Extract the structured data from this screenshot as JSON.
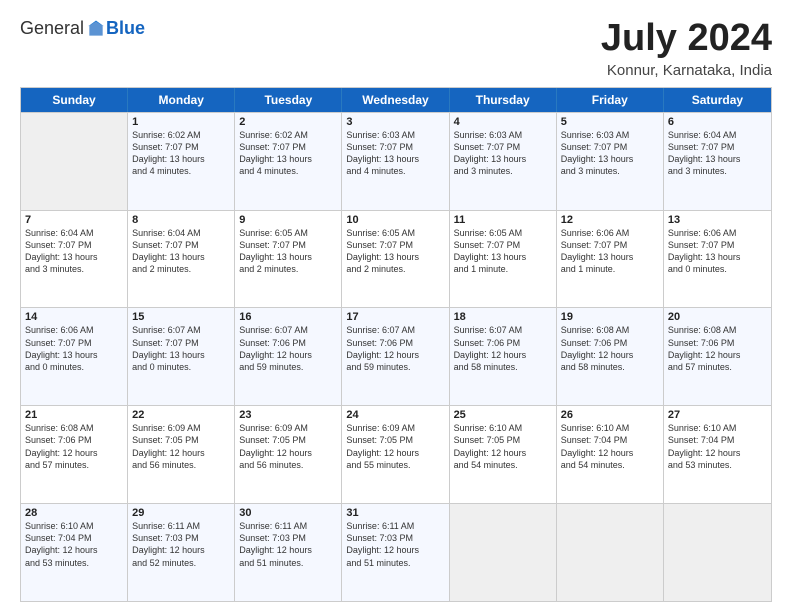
{
  "header": {
    "logo_general": "General",
    "logo_blue": "Blue",
    "month_title": "July 2024",
    "location": "Konnur, Karnataka, India"
  },
  "weekdays": [
    "Sunday",
    "Monday",
    "Tuesday",
    "Wednesday",
    "Thursday",
    "Friday",
    "Saturday"
  ],
  "rows": [
    [
      {
        "day": "",
        "lines": []
      },
      {
        "day": "1",
        "lines": [
          "Sunrise: 6:02 AM",
          "Sunset: 7:07 PM",
          "Daylight: 13 hours",
          "and 4 minutes."
        ]
      },
      {
        "day": "2",
        "lines": [
          "Sunrise: 6:02 AM",
          "Sunset: 7:07 PM",
          "Daylight: 13 hours",
          "and 4 minutes."
        ]
      },
      {
        "day": "3",
        "lines": [
          "Sunrise: 6:03 AM",
          "Sunset: 7:07 PM",
          "Daylight: 13 hours",
          "and 4 minutes."
        ]
      },
      {
        "day": "4",
        "lines": [
          "Sunrise: 6:03 AM",
          "Sunset: 7:07 PM",
          "Daylight: 13 hours",
          "and 3 minutes."
        ]
      },
      {
        "day": "5",
        "lines": [
          "Sunrise: 6:03 AM",
          "Sunset: 7:07 PM",
          "Daylight: 13 hours",
          "and 3 minutes."
        ]
      },
      {
        "day": "6",
        "lines": [
          "Sunrise: 6:04 AM",
          "Sunset: 7:07 PM",
          "Daylight: 13 hours",
          "and 3 minutes."
        ]
      }
    ],
    [
      {
        "day": "7",
        "lines": [
          "Sunrise: 6:04 AM",
          "Sunset: 7:07 PM",
          "Daylight: 13 hours",
          "and 3 minutes."
        ]
      },
      {
        "day": "8",
        "lines": [
          "Sunrise: 6:04 AM",
          "Sunset: 7:07 PM",
          "Daylight: 13 hours",
          "and 2 minutes."
        ]
      },
      {
        "day": "9",
        "lines": [
          "Sunrise: 6:05 AM",
          "Sunset: 7:07 PM",
          "Daylight: 13 hours",
          "and 2 minutes."
        ]
      },
      {
        "day": "10",
        "lines": [
          "Sunrise: 6:05 AM",
          "Sunset: 7:07 PM",
          "Daylight: 13 hours",
          "and 2 minutes."
        ]
      },
      {
        "day": "11",
        "lines": [
          "Sunrise: 6:05 AM",
          "Sunset: 7:07 PM",
          "Daylight: 13 hours",
          "and 1 minute."
        ]
      },
      {
        "day": "12",
        "lines": [
          "Sunrise: 6:06 AM",
          "Sunset: 7:07 PM",
          "Daylight: 13 hours",
          "and 1 minute."
        ]
      },
      {
        "day": "13",
        "lines": [
          "Sunrise: 6:06 AM",
          "Sunset: 7:07 PM",
          "Daylight: 13 hours",
          "and 0 minutes."
        ]
      }
    ],
    [
      {
        "day": "14",
        "lines": [
          "Sunrise: 6:06 AM",
          "Sunset: 7:07 PM",
          "Daylight: 13 hours",
          "and 0 minutes."
        ]
      },
      {
        "day": "15",
        "lines": [
          "Sunrise: 6:07 AM",
          "Sunset: 7:07 PM",
          "Daylight: 13 hours",
          "and 0 minutes."
        ]
      },
      {
        "day": "16",
        "lines": [
          "Sunrise: 6:07 AM",
          "Sunset: 7:06 PM",
          "Daylight: 12 hours",
          "and 59 minutes."
        ]
      },
      {
        "day": "17",
        "lines": [
          "Sunrise: 6:07 AM",
          "Sunset: 7:06 PM",
          "Daylight: 12 hours",
          "and 59 minutes."
        ]
      },
      {
        "day": "18",
        "lines": [
          "Sunrise: 6:07 AM",
          "Sunset: 7:06 PM",
          "Daylight: 12 hours",
          "and 58 minutes."
        ]
      },
      {
        "day": "19",
        "lines": [
          "Sunrise: 6:08 AM",
          "Sunset: 7:06 PM",
          "Daylight: 12 hours",
          "and 58 minutes."
        ]
      },
      {
        "day": "20",
        "lines": [
          "Sunrise: 6:08 AM",
          "Sunset: 7:06 PM",
          "Daylight: 12 hours",
          "and 57 minutes."
        ]
      }
    ],
    [
      {
        "day": "21",
        "lines": [
          "Sunrise: 6:08 AM",
          "Sunset: 7:06 PM",
          "Daylight: 12 hours",
          "and 57 minutes."
        ]
      },
      {
        "day": "22",
        "lines": [
          "Sunrise: 6:09 AM",
          "Sunset: 7:05 PM",
          "Daylight: 12 hours",
          "and 56 minutes."
        ]
      },
      {
        "day": "23",
        "lines": [
          "Sunrise: 6:09 AM",
          "Sunset: 7:05 PM",
          "Daylight: 12 hours",
          "and 56 minutes."
        ]
      },
      {
        "day": "24",
        "lines": [
          "Sunrise: 6:09 AM",
          "Sunset: 7:05 PM",
          "Daylight: 12 hours",
          "and 55 minutes."
        ]
      },
      {
        "day": "25",
        "lines": [
          "Sunrise: 6:10 AM",
          "Sunset: 7:05 PM",
          "Daylight: 12 hours",
          "and 54 minutes."
        ]
      },
      {
        "day": "26",
        "lines": [
          "Sunrise: 6:10 AM",
          "Sunset: 7:04 PM",
          "Daylight: 12 hours",
          "and 54 minutes."
        ]
      },
      {
        "day": "27",
        "lines": [
          "Sunrise: 6:10 AM",
          "Sunset: 7:04 PM",
          "Daylight: 12 hours",
          "and 53 minutes."
        ]
      }
    ],
    [
      {
        "day": "28",
        "lines": [
          "Sunrise: 6:10 AM",
          "Sunset: 7:04 PM",
          "Daylight: 12 hours",
          "and 53 minutes."
        ]
      },
      {
        "day": "29",
        "lines": [
          "Sunrise: 6:11 AM",
          "Sunset: 7:03 PM",
          "Daylight: 12 hours",
          "and 52 minutes."
        ]
      },
      {
        "day": "30",
        "lines": [
          "Sunrise: 6:11 AM",
          "Sunset: 7:03 PM",
          "Daylight: 12 hours",
          "and 51 minutes."
        ]
      },
      {
        "day": "31",
        "lines": [
          "Sunrise: 6:11 AM",
          "Sunset: 7:03 PM",
          "Daylight: 12 hours",
          "and 51 minutes."
        ]
      },
      {
        "day": "",
        "lines": []
      },
      {
        "day": "",
        "lines": []
      },
      {
        "day": "",
        "lines": []
      }
    ]
  ]
}
